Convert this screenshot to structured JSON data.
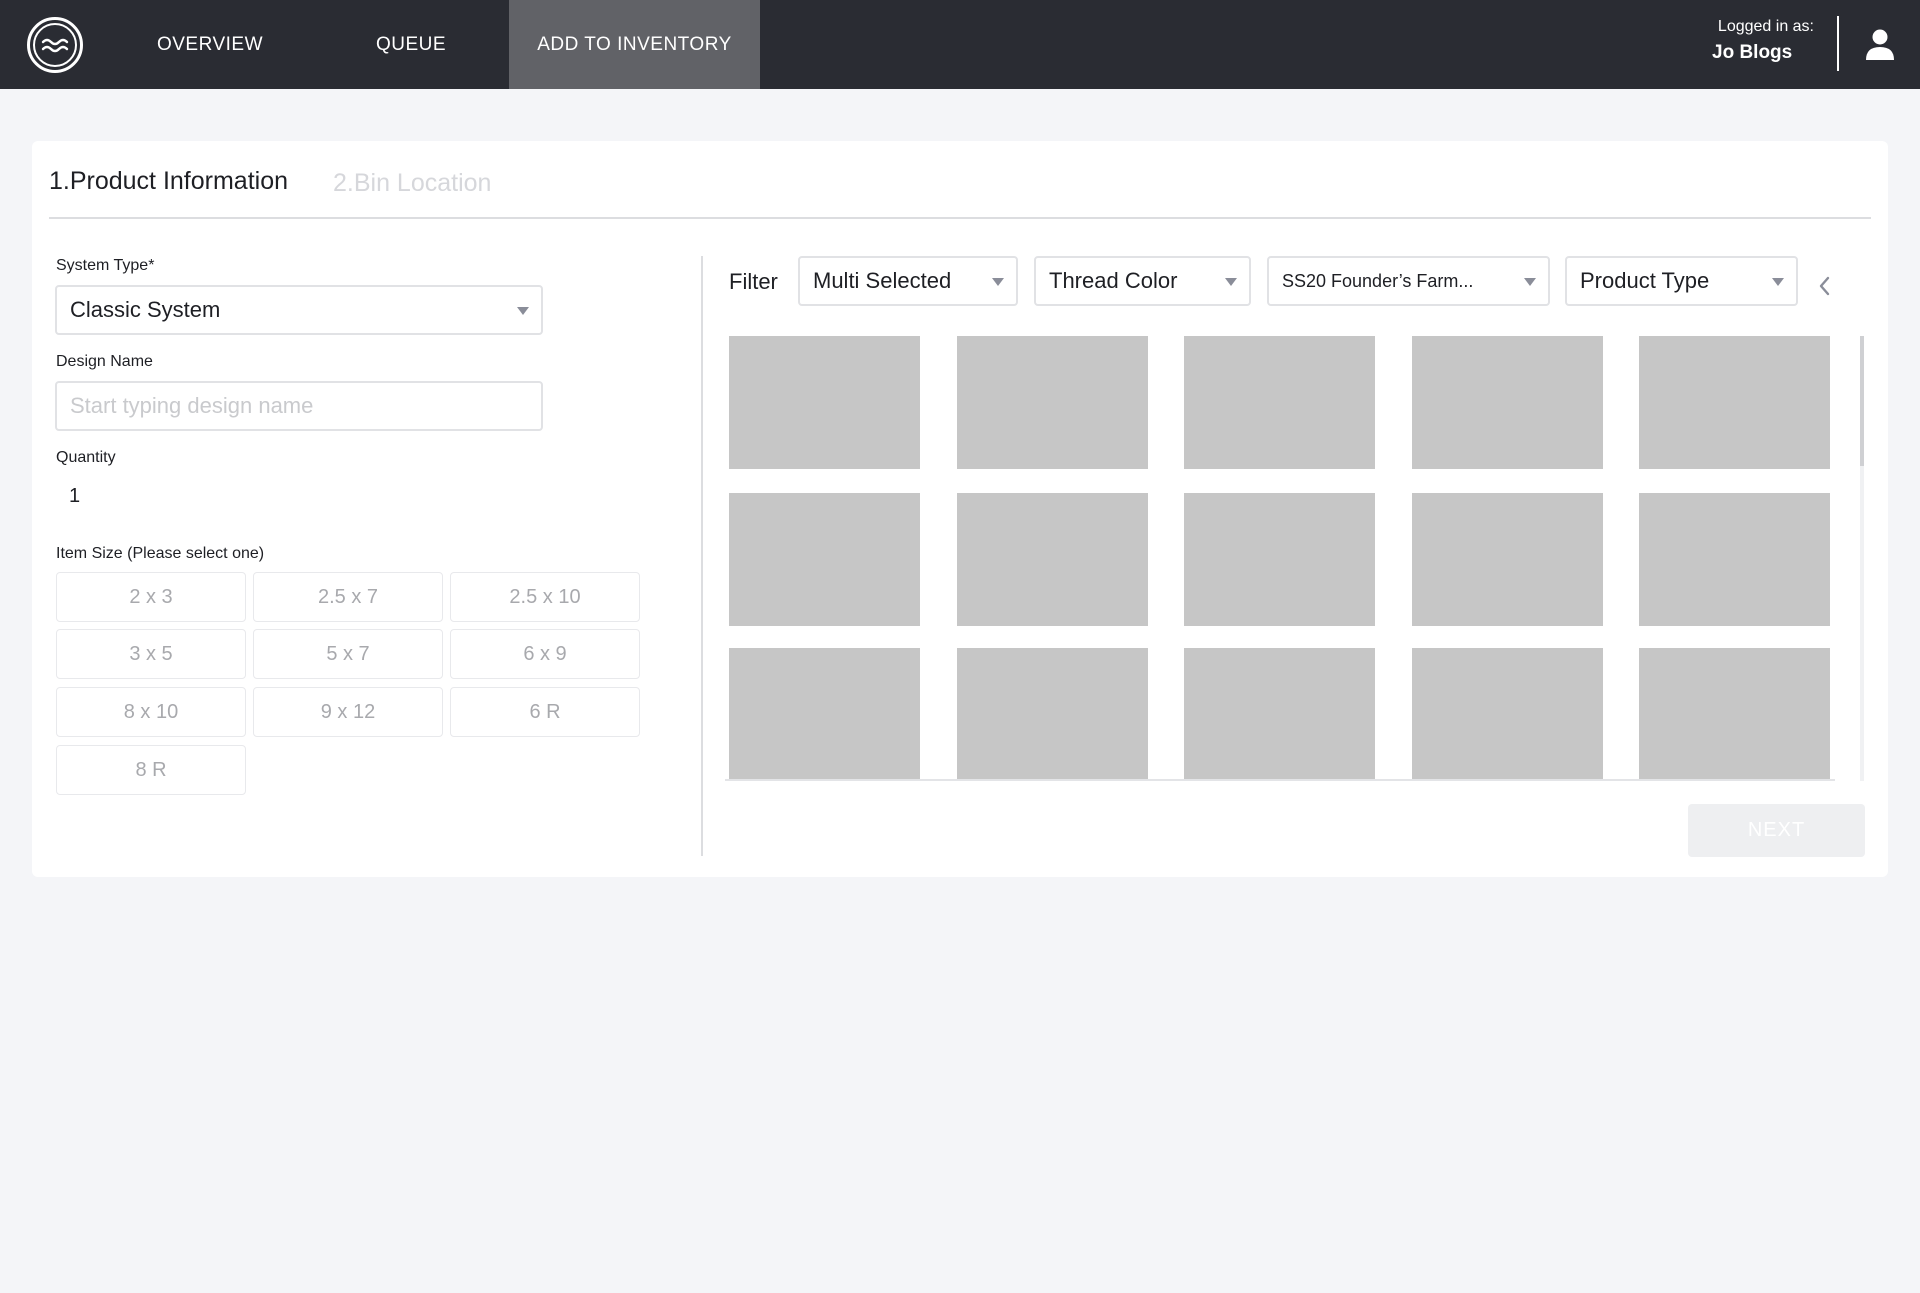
{
  "nav": {
    "items": [
      {
        "label": "OVERVIEW"
      },
      {
        "label": "QUEUE"
      },
      {
        "label": "ADD TO INVENTORY",
        "active": true
      }
    ],
    "logged_in_label": "Logged in as:",
    "user_name": "Jo Blogs"
  },
  "steps": {
    "step1": "1.Product Information",
    "step2": "2.Bin Location"
  },
  "form": {
    "system_type_label": "System Type*",
    "system_type_value": "Classic System",
    "design_name_label": "Design Name",
    "design_name_placeholder": "Start typing design name",
    "design_name_value": "",
    "quantity_label": "Quantity",
    "quantity_value": "1",
    "item_size_label": "Item Size (Please select one)",
    "sizes": [
      "2 x 3",
      "2.5 x 7",
      "2.5 x 10",
      "3 x 5",
      "5 x 7",
      "6 x 9",
      "8 x 10",
      "9 x 12",
      "6 R",
      "8 R"
    ]
  },
  "filters": {
    "label": "Filter",
    "items": [
      {
        "value": "Multi Selected"
      },
      {
        "value": "Thread Color"
      },
      {
        "value": "SS20 Founder’s Farm..."
      },
      {
        "value": "Product Type"
      }
    ]
  },
  "gallery": {
    "rows": 3,
    "columns": 5,
    "tile_color": "#c6c6c6"
  },
  "actions": {
    "next_label": "NEXT"
  },
  "colors": {
    "nav_bg": "#2a2c33",
    "nav_active_bg": "#616267",
    "page_bg": "#f4f5f8",
    "card_bg": "#ffffff"
  }
}
